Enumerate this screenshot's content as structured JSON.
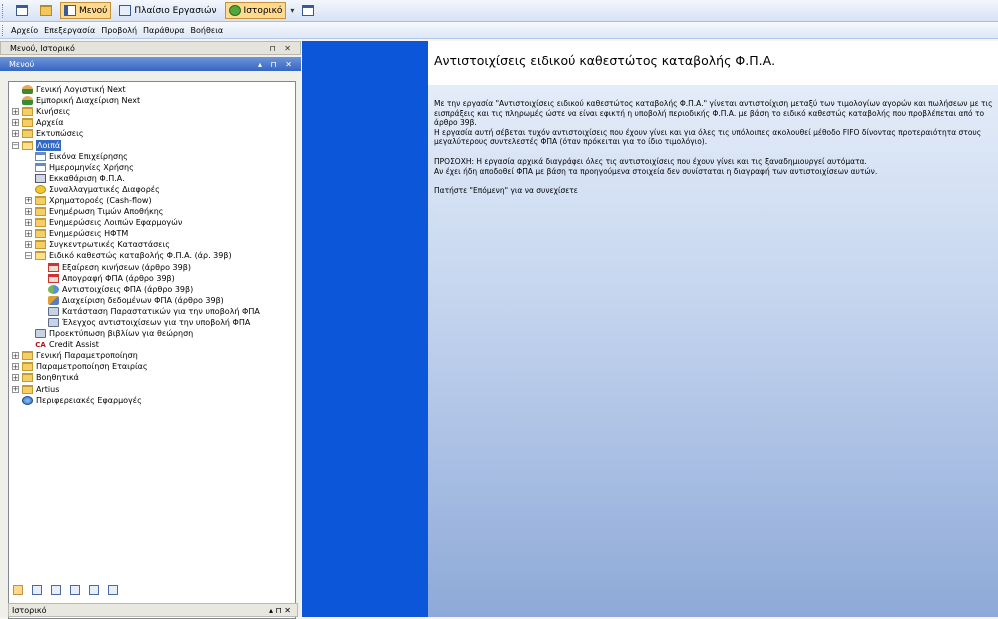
{
  "toolbar": {
    "menu_label": "Μενού",
    "workspace_label": "Πλαίσιο Εργασιών",
    "history_label": "Ιστορικό"
  },
  "menubar": [
    "Αρχείο",
    "Επεξεργασία",
    "Προβολή",
    "Παράθυρα",
    "Βοήθεια"
  ],
  "left_pane": {
    "caption": "Μενού, Ιστορικό",
    "menu_caption": "Μενού",
    "history_caption": "Ιστορικό",
    "caption_controls": "▾ ⊓ ✕"
  },
  "tree": [
    {
      "label": "Γενική Λογιστική Next",
      "level": 0,
      "icon": "person-icon",
      "expander": ""
    },
    {
      "label": "Εμπορική Διαχείριση Next",
      "level": 0,
      "icon": "person-icon",
      "expander": ""
    },
    {
      "label": "Κινήσεις",
      "level": 0,
      "icon": "folder-icon",
      "expander": "+"
    },
    {
      "label": "Αρχεία",
      "level": 0,
      "icon": "folder-icon",
      "expander": "+"
    },
    {
      "label": "Εκτυπώσεις",
      "level": 0,
      "icon": "folder-icon",
      "expander": "+"
    },
    {
      "label": "Λοιπά",
      "level": 0,
      "icon": "folder-open-icon",
      "expander": "−",
      "selected": true
    },
    {
      "label": "Εικόνα Επιχείρησης",
      "level": 1,
      "icon": "chart-icon",
      "expander": ""
    },
    {
      "label": "Ημερομηνίες Χρήσης",
      "level": 1,
      "icon": "calendar-icon",
      "expander": ""
    },
    {
      "label": "Εκκαθάριση Φ.Π.Α.",
      "level": 1,
      "icon": "calculator-icon",
      "expander": ""
    },
    {
      "label": "Συναλλαγματικές Διαφορές",
      "level": 1,
      "icon": "coin-icon",
      "expander": ""
    },
    {
      "label": "Χρηματοροές (Cash-flow)",
      "level": 1,
      "icon": "folder-icon",
      "expander": "+"
    },
    {
      "label": "Ενημέρωση Τιμών Αποθήκης",
      "level": 1,
      "icon": "folder-icon",
      "expander": "+"
    },
    {
      "label": "Ενημερώσεις Λοιπών Εφαρμογών",
      "level": 1,
      "icon": "folder-icon",
      "expander": "+"
    },
    {
      "label": "Ενημερώσεις ΗΦΤΜ",
      "level": 1,
      "icon": "folder-icon",
      "expander": "+"
    },
    {
      "label": "Συγκεντρωτικές Καταστάσεις",
      "level": 1,
      "icon": "folder-icon",
      "expander": "+"
    },
    {
      "label": "Ειδικό καθεστώς καταβολής Φ.Π.Α. (άρ. 39β)",
      "level": 1,
      "icon": "folder-open-icon",
      "expander": "−"
    },
    {
      "label": "Εξαίρεση κινήσεων (άρθρο 39β)",
      "level": 2,
      "icon": "exclusion-icon",
      "expander": ""
    },
    {
      "label": "Απογραφή ΦΠΑ (άρθρο 39β)",
      "level": 2,
      "icon": "inventory-icon",
      "expander": ""
    },
    {
      "label": "Αντιστοιχίσεις ΦΠΑ (άρθρο 39β)",
      "level": 2,
      "icon": "match-icon",
      "expander": ""
    },
    {
      "label": "Διαχείριση δεδομένων ΦΠΑ (άρθρο 39β)",
      "level": 2,
      "icon": "data-icon",
      "expander": ""
    },
    {
      "label": "Κατάσταση Παραστατικών για την υποβολή ΦΠΑ",
      "level": 2,
      "icon": "print-icon",
      "expander": ""
    },
    {
      "label": "Έλεγχος αντιστοιχίσεων για την υποβολή ΦΠΑ",
      "level": 2,
      "icon": "print-icon",
      "expander": ""
    },
    {
      "label": "Προεκτύπωση βιβλίων για θεώρηση",
      "level": 1,
      "icon": "print-icon",
      "expander": ""
    },
    {
      "label": "Credit Assist",
      "level": 1,
      "icon": "credit-assist-icon",
      "expander": ""
    },
    {
      "label": "Γενική Παραμετροποίηση",
      "level": 0,
      "icon": "folder-icon",
      "expander": "+"
    },
    {
      "label": "Παραμετροποίηση Εταιρίας",
      "level": 0,
      "icon": "folder-icon",
      "expander": "+"
    },
    {
      "label": "Βοηθητικά",
      "level": 0,
      "icon": "folder-icon",
      "expander": "+"
    },
    {
      "label": "Artius",
      "level": 0,
      "icon": "folder-icon",
      "expander": "+"
    },
    {
      "label": "Περιφερειακές Εφαρμογές",
      "level": 0,
      "icon": "globe-icon",
      "expander": ""
    }
  ],
  "content": {
    "title": "Αντιστοιχίσεις ειδικού καθεστώτος καταβολής Φ.Π.Α.",
    "paragraphs": [
      "Με την εργασία \"Αντιστοιχίσεις ειδικού καθεστώτος καταβολής Φ.Π.Α.\" γίνεται αντιστοίχιση μεταξύ των τιμολογίων αγορών και πωλήσεων με τις εισπράξεις και τις πληρωμές ώστε να είναι εφικτή η υποβολή περιοδικής Φ.Π.Α. με βάση το ειδικό καθεστώς καταβολής που προβλέπεται από το άρθρο 39β.",
      "Η εργασία αυτή σέβεται τυχόν αντιστοιχίσεις που έχουν γίνει και για όλες τις υπόλοιπες ακολουθεί μέθοδο FIFO δίνοντας προτεραιότητα στους μεγαλύτερους συντελεστές ΦΠΑ (όταν πρόκειται για το ίδιο τιμολόγιο).",
      "ΠΡΟΣΟΧΗ: Η εργασία αρχικά διαγράφει όλες τις αντιστοιχίσεις που έχουν γίνει και τις ξαναδημιουργεί αυτόματα.",
      "Αν έχει ήδη αποδοθεί ΦΠΑ με βάση τα προηγούμενα στοιχεία δεν συνίσταται η διαγραφή των αντιστοιχίσεων αυτών.",
      "Πατήστε \"Επόμενη\" για να συνεχίσετε"
    ]
  },
  "colors": {
    "selected": "#316ac5",
    "band": "#0b56d9",
    "toolbar_active": "#ffd98e"
  }
}
